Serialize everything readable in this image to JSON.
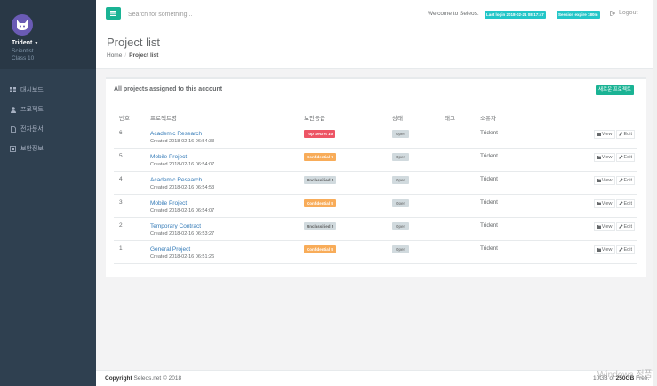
{
  "profile": {
    "name": "Trident",
    "role": "Scientist",
    "class": "Class 10"
  },
  "sidebar": {
    "items": [
      {
        "label": "대시보드",
        "icon": "dashboard-icon"
      },
      {
        "label": "프로젝트",
        "icon": "user-icon"
      },
      {
        "label": "전자문서",
        "icon": "file-icon"
      },
      {
        "label": "보안정보",
        "icon": "security-icon"
      }
    ]
  },
  "topbar": {
    "search_placeholder": "Search for something...",
    "welcome": "Welcome to Seleos.",
    "last_login": "Last login 2018-02-21 08:17:47",
    "session": "Session expire 180m",
    "logout": "Logout"
  },
  "page": {
    "title": "Project list",
    "breadcrumb_home": "Home",
    "breadcrumb_current": "Project list"
  },
  "panel": {
    "title": "All projects assigned to this account",
    "new_button": "새로운 프로젝트"
  },
  "table": {
    "headers": {
      "no": "번호",
      "name": "프로젝트명",
      "security": "보안등급",
      "status": "상태",
      "tag": "태그",
      "owner": "소유자"
    },
    "view_label": "View",
    "edit_label": "Edit",
    "rows": [
      {
        "no": "6",
        "name": "Academic Research",
        "created": "Created 2018-02-16 06:54:33",
        "security": "Top Secret 10",
        "security_level": "danger",
        "status": "Open",
        "tag": "",
        "owner": "Trident"
      },
      {
        "no": "5",
        "name": "Mobile Project",
        "created": "Created 2018-02-16 06:54:07",
        "security": "Confidential 7",
        "security_level": "warning",
        "status": "Open",
        "tag": "",
        "owner": "Trident"
      },
      {
        "no": "4",
        "name": "Academic Research",
        "created": "Created 2018-02-16 06:54:53",
        "security": "Unclassified 5",
        "security_level": "default",
        "status": "Open",
        "tag": "",
        "owner": "Trident"
      },
      {
        "no": "3",
        "name": "Mobile Project",
        "created": "Created 2018-02-16 06:54:07",
        "security": "Confidential 5",
        "security_level": "warning",
        "status": "Open",
        "tag": "",
        "owner": "Trident"
      },
      {
        "no": "2",
        "name": "Temporary Contract",
        "created": "Created 2018-02-16 06:53:27",
        "security": "Unclassified 5",
        "security_level": "default",
        "status": "Open",
        "tag": "",
        "owner": "Trident"
      },
      {
        "no": "1",
        "name": "General Project",
        "created": "Created 2018-02-16 06:51:26",
        "security": "Confidential 5",
        "security_level": "warning",
        "status": "Open",
        "tag": "",
        "owner": "Trident"
      }
    ]
  },
  "footer": {
    "copyright_bold": "Copyright",
    "copyright_rest": "Seleos.net © 2018",
    "storage_prefix": "10GB of",
    "storage_bold": "250GB",
    "storage_suffix": "Free."
  },
  "watermark": "Windows 정품",
  "colors": {
    "accent": "#1ab394",
    "info": "#23c6c8",
    "danger": "#ed5565",
    "warning": "#f8ac59",
    "sidebar": "#2f4050"
  }
}
